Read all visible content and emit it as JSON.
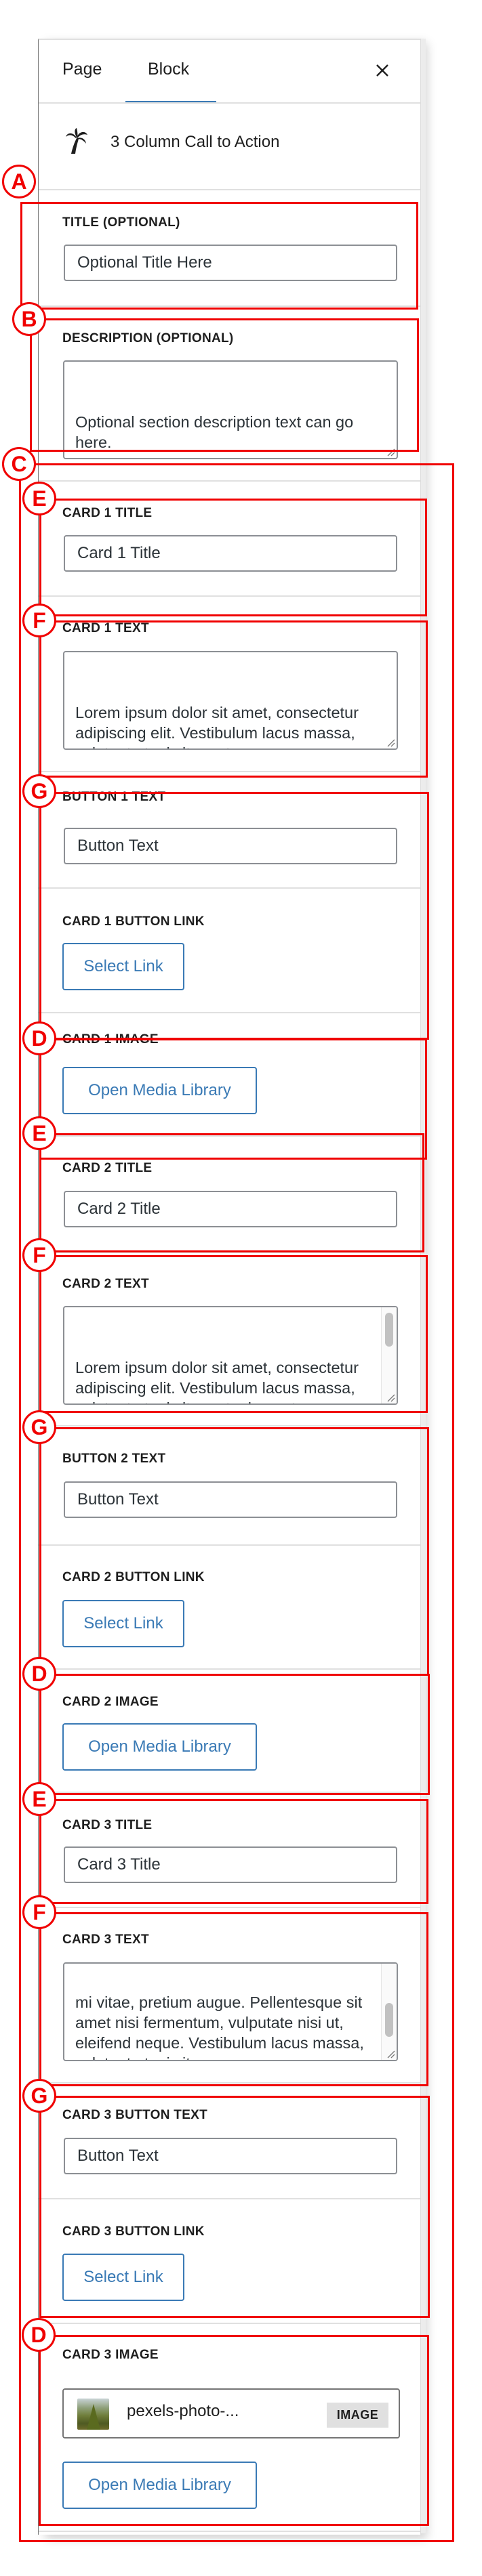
{
  "tabs": [
    {
      "label": "Page",
      "active": false
    },
    {
      "label": "Block",
      "active": true
    }
  ],
  "close_icon": "close-icon",
  "block": {
    "icon": "palm-tree-icon",
    "title": "3 Column Call to Action"
  },
  "accent_color": "#3a7ab5",
  "annotation_color": "#f00000",
  "fields": {
    "title": {
      "label": "Title (Optional)",
      "value": "Optional Title Here"
    },
    "description": {
      "label": "Description (Optional)",
      "value": "Optional section description text can go here."
    },
    "card1_title": {
      "label": "Card 1 Title",
      "value": "Card 1 Title"
    },
    "card1_text": {
      "label": "Card 1 Text",
      "value": "Lorem ipsum dolor sit amet, consectetur adipiscing elit. Vestibulum lacus massa, volutpat at mi sit amet."
    },
    "button1_text": {
      "label": "Button 1 Text",
      "value": "Button Text"
    },
    "card1_button_link": {
      "label": "Card 1 Button Link",
      "button": "Select Link"
    },
    "card1_image": {
      "label": "Card 1 Image",
      "button": "Open Media Library"
    },
    "card2_title": {
      "label": "Card 2 Title",
      "value": "Card 2 Title"
    },
    "card2_text": {
      "label": "Card 2 Text",
      "value": "Lorem ipsum dolor sit amet, consectetur adipiscing elit. Vestibulum lacus massa, volutpat at mi sit amet, elementum tincidunt augue. Sed eleifend, neque non"
    },
    "button2_text": {
      "label": "Button 2 Text",
      "value": "Button Text"
    },
    "card2_button_link": {
      "label": "Card 2 Button Link",
      "button": "Select Link"
    },
    "card2_image": {
      "label": "Card 2 Image",
      "button": "Open Media Library"
    },
    "card3_title": {
      "label": "Card 3 Title",
      "value": "Card 3 Title"
    },
    "card3_text": {
      "label": "Card 3 Text",
      "value": "mi vitae, pretium augue. Pellentesque sit amet nisi fermentum, vulputate nisi ut, eleifend neque. Vestibulum lacus massa, volutpat at mi sit am."
    },
    "card3_button_text": {
      "label": "Card 3 Button Text",
      "value": "Button Text"
    },
    "card3_button_link": {
      "label": "Card 3 Button Link",
      "button": "Select Link"
    },
    "card3_image": {
      "label": "Card 3 Image",
      "file_name": "pexels-photo-...",
      "file_type": "IMAGE",
      "button": "Open Media Library"
    }
  },
  "annotations": [
    "A",
    "B",
    "C",
    "D",
    "E",
    "F",
    "G",
    "D",
    "E",
    "F",
    "G",
    "D",
    "E",
    "F",
    "G",
    "D"
  ]
}
